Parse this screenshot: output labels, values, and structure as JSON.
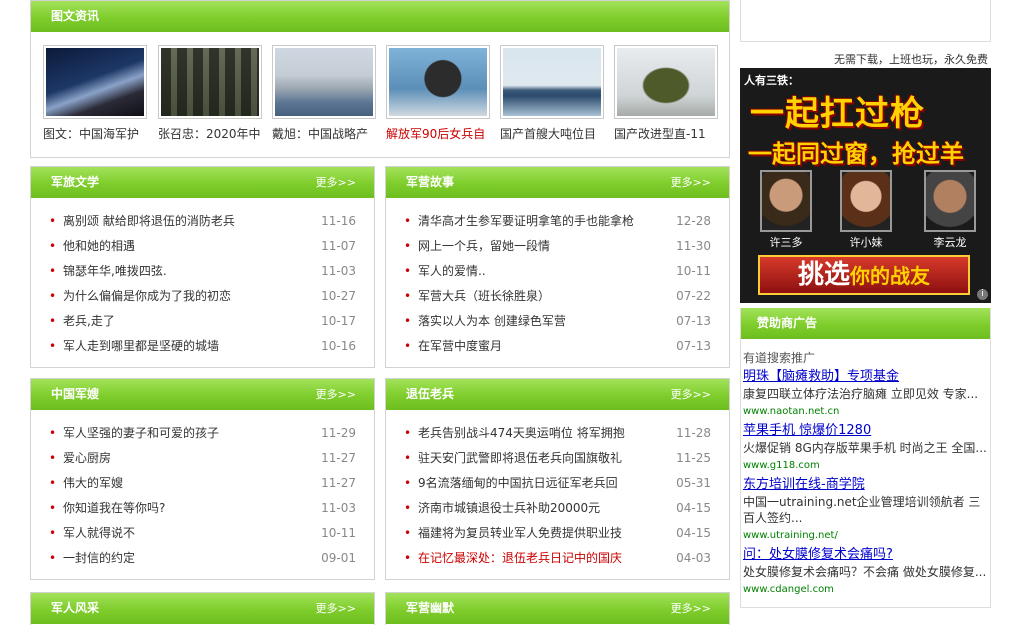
{
  "photo_news": {
    "title": "图文资讯",
    "items": [
      {
        "caption": "图文：中国海军护",
        "red": false
      },
      {
        "caption": "张召忠：2020年中",
        "red": false
      },
      {
        "caption": "戴旭：中国战略产",
        "red": false
      },
      {
        "caption": "解放军90后女兵自",
        "red": true
      },
      {
        "caption": "国产首艘大吨位目",
        "red": false
      },
      {
        "caption": "国产改进型直-11",
        "red": false
      }
    ]
  },
  "sections": [
    {
      "title": "军旅文学",
      "more": "更多>>",
      "items": [
        {
          "text": "离别颂 献给即将退伍的消防老兵",
          "date": "11-16"
        },
        {
          "text": "他和她的相遇",
          "date": "11-07"
        },
        {
          "text": "锦瑟年华,唯拨四弦.",
          "date": "11-03"
        },
        {
          "text": "为什么偏偏是你成为了我的初恋",
          "date": "10-27"
        },
        {
          "text": "老兵,走了",
          "date": "10-17"
        },
        {
          "text": "军人走到哪里都是坚硬的城墙",
          "date": "10-16"
        }
      ]
    },
    {
      "title": "军营故事",
      "more": "更多>>",
      "items": [
        {
          "text": "清华高才生参军要证明拿笔的手也能拿枪",
          "date": "12-28"
        },
        {
          "text": "网上一个兵，留她一段情",
          "date": "11-30"
        },
        {
          "text": "军人的爱情..",
          "date": "10-11"
        },
        {
          "text": "军营大兵（班长徐胜泉）",
          "date": "07-22"
        },
        {
          "text": "落实以人为本 创建绿色军营",
          "date": "07-13"
        },
        {
          "text": "在军营中度蜜月",
          "date": "07-13"
        }
      ]
    },
    {
      "title": "中国军嫂",
      "more": "更多>>",
      "items": [
        {
          "text": "军人坚强的妻子和可爱的孩子",
          "date": "11-29"
        },
        {
          "text": "爱心厨房",
          "date": "11-27"
        },
        {
          "text": "伟大的军嫂",
          "date": "11-27"
        },
        {
          "text": "你知道我在等你吗?",
          "date": "11-03"
        },
        {
          "text": "军人就得说不",
          "date": "10-11"
        },
        {
          "text": "一封信的约定",
          "date": "09-01"
        }
      ]
    },
    {
      "title": "退伍老兵",
      "more": "更多>>",
      "items": [
        {
          "text": "老兵告别战斗474天奥运哨位 将军拥抱",
          "date": "11-28"
        },
        {
          "text": "驻天安门武警即将退伍老兵向国旗敬礼",
          "date": "11-25"
        },
        {
          "text": "9名流落缅甸的中国抗日远征军老兵回",
          "date": "05-31"
        },
        {
          "text": "济南市城镇退役士兵补助20000元",
          "date": "04-15"
        },
        {
          "text": "福建将为复员转业军人免费提供职业技",
          "date": "04-15"
        },
        {
          "text": "在记忆最深处：退伍老兵日记中的国庆",
          "date": "04-03",
          "red": true
        }
      ]
    },
    {
      "title": "军人风采",
      "more": "更多>>",
      "items": []
    },
    {
      "title": "军营幽默",
      "more": "更多>>",
      "items": []
    }
  ],
  "banner_ad": {
    "topline": "无需下载，上班也玩，永久免费",
    "line1": "人有三铁：",
    "big1": "一起扛过枪",
    "big2": "一起同过窗，抢过羊",
    "names": [
      "许三多",
      "许小妹",
      "李云龙"
    ],
    "cta_a": "挑选",
    "cta_b": "你的战友",
    "info": "i"
  },
  "sponsor": {
    "title": "赞助商广告",
    "source": "有道搜索推广",
    "ads": [
      {
        "headline": "明珠【脑瘫救助】专项基金",
        "body": "康复四联立体疗法治疗脑瘫 立即见效 专家...",
        "url": "www.naotan.net.cn"
      },
      {
        "headline": "苹果手机 惊爆价1280",
        "body": "火爆促销 8G内存版苹果手机 时尚之王 全国...",
        "url": "www.g118.com"
      },
      {
        "headline": "东方培训在线-商学院",
        "body": "中国一utraining.net企业管理培训领航者 三百人签约...",
        "url": "www.utraining.net/"
      },
      {
        "headline": "问：处女膜修复术会痛吗?",
        "body": "处女膜修复术会痛吗？不会痛 做处女膜修复...",
        "url": "www.cdangel.com"
      }
    ]
  },
  "colors": {
    "accent_green": "#7fcd2c",
    "dot_red": "#cc0000",
    "link_blue": "#0000cc",
    "url_green": "#008000"
  }
}
